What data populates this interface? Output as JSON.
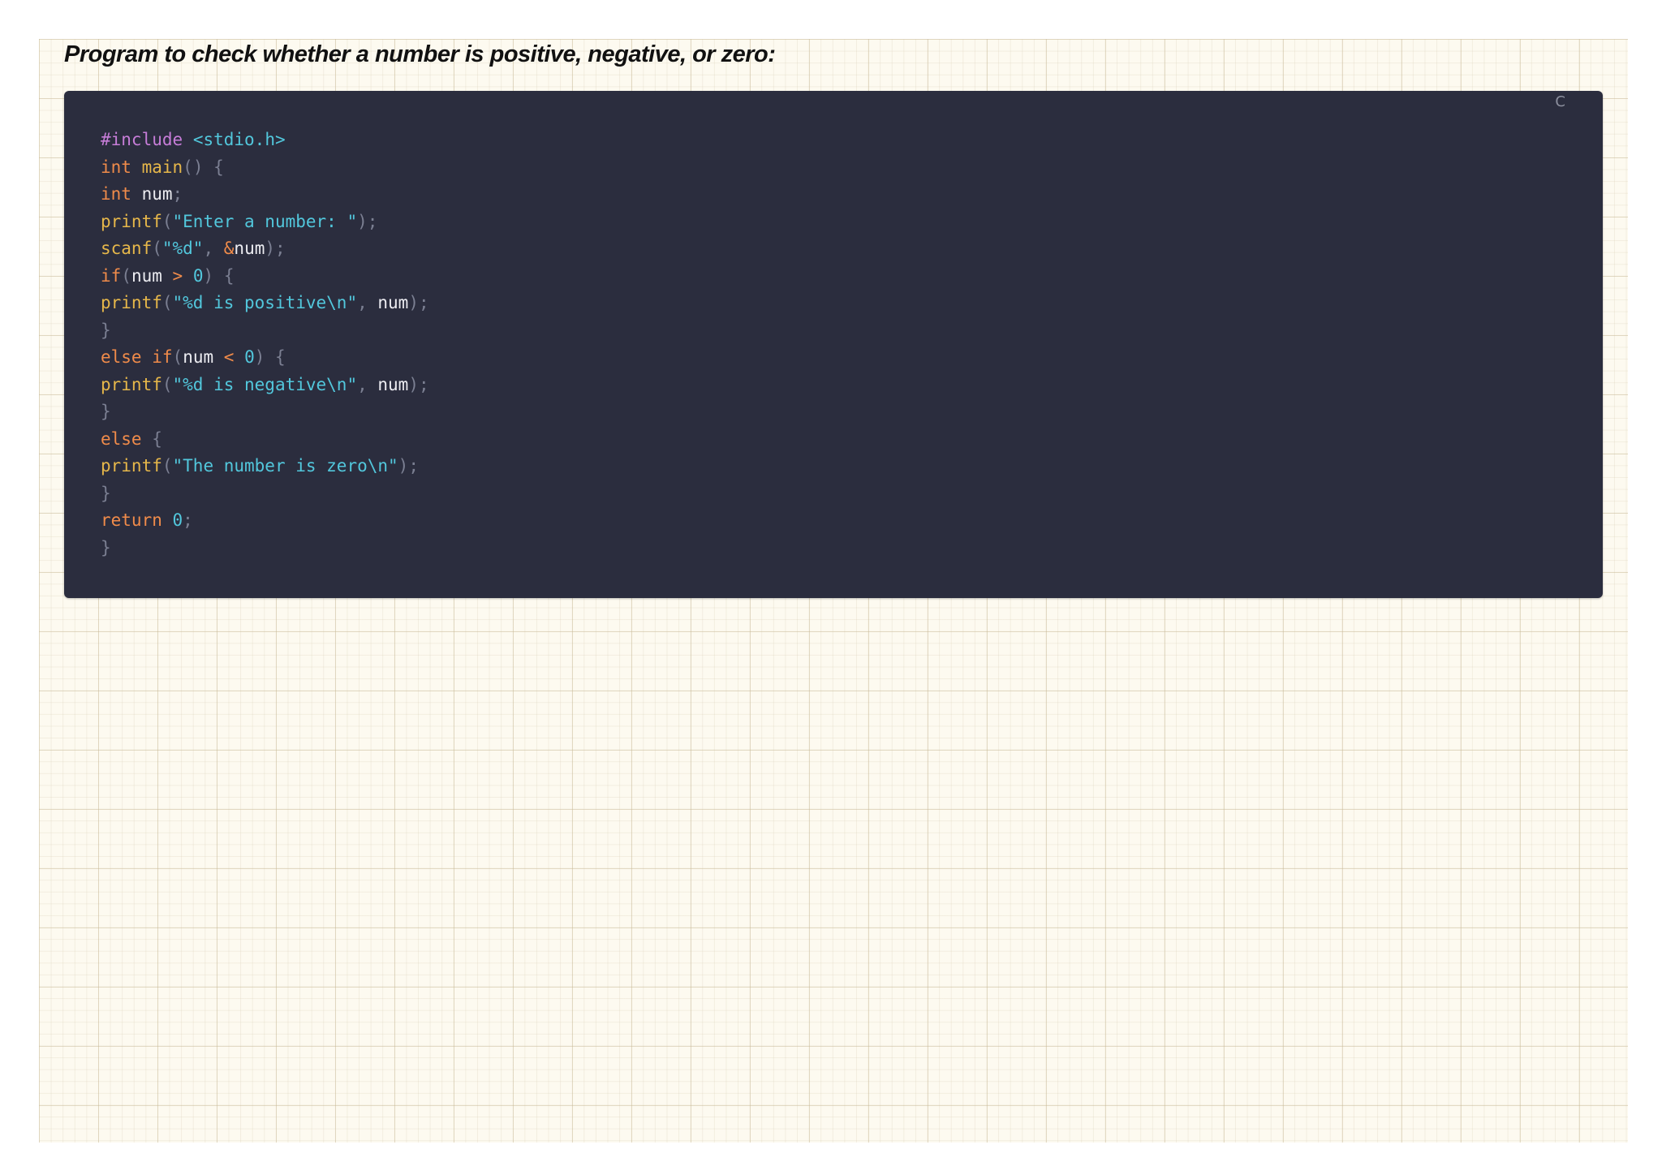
{
  "heading": "Program to check whether a number is positive, negative, or zero:",
  "code_block": {
    "language": "C",
    "lines": [
      [
        [
          "pre",
          "#include"
        ],
        [
          "id",
          " "
        ],
        [
          "str",
          "<stdio.h>"
        ]
      ],
      [
        [
          "kw",
          "int"
        ],
        [
          "id",
          " "
        ],
        [
          "fn",
          "main"
        ],
        [
          "punc",
          "()"
        ],
        [
          "id",
          " "
        ],
        [
          "punc",
          "{"
        ]
      ],
      [
        [
          "kw",
          "int"
        ],
        [
          "id",
          " num"
        ],
        [
          "punc",
          ";"
        ]
      ],
      [
        [
          "fn",
          "printf"
        ],
        [
          "punc",
          "("
        ],
        [
          "str",
          "\"Enter a number: \""
        ],
        [
          "punc",
          ");"
        ]
      ],
      [
        [
          "fn",
          "scanf"
        ],
        [
          "punc",
          "("
        ],
        [
          "str",
          "\"%d\""
        ],
        [
          "punc",
          ","
        ],
        [
          "id",
          " "
        ],
        [
          "op",
          "&"
        ],
        [
          "id",
          "num"
        ],
        [
          "punc",
          ");"
        ]
      ],
      [
        [
          "kw",
          "if"
        ],
        [
          "punc",
          "("
        ],
        [
          "id",
          "num "
        ],
        [
          "op",
          ">"
        ],
        [
          "id",
          " "
        ],
        [
          "num",
          "0"
        ],
        [
          "punc",
          ")"
        ],
        [
          "id",
          " "
        ],
        [
          "punc",
          "{"
        ]
      ],
      [
        [
          "fn",
          "printf"
        ],
        [
          "punc",
          "("
        ],
        [
          "str",
          "\"%d is positive\\n\""
        ],
        [
          "punc",
          ","
        ],
        [
          "id",
          " num"
        ],
        [
          "punc",
          ");"
        ]
      ],
      [
        [
          "punc",
          "}"
        ]
      ],
      [
        [
          "kw",
          "else"
        ],
        [
          "id",
          " "
        ],
        [
          "kw",
          "if"
        ],
        [
          "punc",
          "("
        ],
        [
          "id",
          "num "
        ],
        [
          "op",
          "<"
        ],
        [
          "id",
          " "
        ],
        [
          "num",
          "0"
        ],
        [
          "punc",
          ")"
        ],
        [
          "id",
          " "
        ],
        [
          "punc",
          "{"
        ]
      ],
      [
        [
          "fn",
          "printf"
        ],
        [
          "punc",
          "("
        ],
        [
          "str",
          "\"%d is negative\\n\""
        ],
        [
          "punc",
          ","
        ],
        [
          "id",
          " num"
        ],
        [
          "punc",
          ");"
        ]
      ],
      [
        [
          "punc",
          "}"
        ]
      ],
      [
        [
          "kw",
          "else"
        ],
        [
          "id",
          " "
        ],
        [
          "punc",
          "{"
        ]
      ],
      [
        [
          "fn",
          "printf"
        ],
        [
          "punc",
          "("
        ],
        [
          "str",
          "\"The number is zero\\n\""
        ],
        [
          "punc",
          ");"
        ]
      ],
      [
        [
          "punc",
          "}"
        ]
      ],
      [
        [
          "kw",
          "return"
        ],
        [
          "id",
          " "
        ],
        [
          "num",
          "0"
        ],
        [
          "punc",
          ";"
        ]
      ],
      [
        [
          "punc",
          "}"
        ]
      ]
    ]
  },
  "colors": {
    "code_background": "#2b2d3e",
    "page_background": "#fdfaf0",
    "keyword": "#f08b4a",
    "function": "#e6b74a",
    "string": "#52c7dc",
    "preprocessor": "#c77dd8",
    "punctuation": "#7b7f92"
  }
}
